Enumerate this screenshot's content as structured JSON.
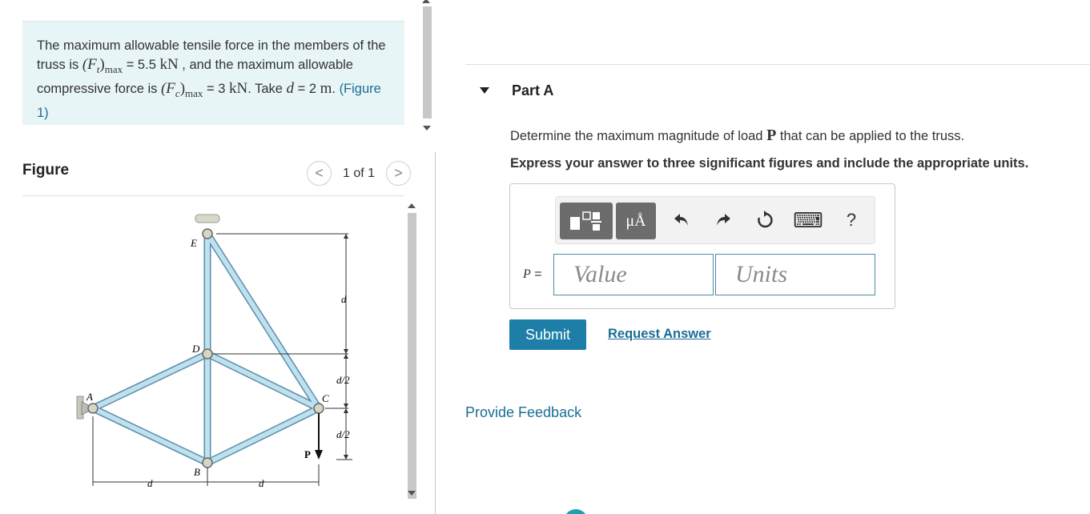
{
  "problem": {
    "text1": "The maximum allowable tensile force in the members of the truss is ",
    "ft_symbol": "(F",
    "ft_sub": "t",
    "ft_close": ")",
    "ft_max": "max",
    "ft_value": " = 5.5 ",
    "ft_unit": "kN",
    "text2": " , and the maximum allowable compressive force is ",
    "fc_symbol": "(F",
    "fc_sub": "c",
    "fc_close": ")",
    "fc_max": "max",
    "fc_value": " = 3 ",
    "fc_unit": "kN",
    "text3": ". Take ",
    "d_symbol": "d",
    "d_value": " = 2 ",
    "d_unit": "m",
    "text4": ". ",
    "figure_link": "(Figure 1)"
  },
  "figure": {
    "title": "Figure",
    "pager_text": "1 of 1",
    "prev_glyph": "<",
    "next_glyph": ">",
    "labels": {
      "E": "E",
      "D": "D",
      "A": "A",
      "C": "C",
      "B": "B",
      "P": "P",
      "d_right": "d",
      "d2_upper": "d/2",
      "d2_lower": "d/2",
      "d_bottom_left": "d",
      "d_bottom_right": "d"
    }
  },
  "part": {
    "title": "Part A",
    "question_pre": "Determine the maximum magnitude of load ",
    "question_var": "P",
    "question_post": " that can be applied to the truss.",
    "instruction": "Express your answer to three significant figures and include the appropriate units."
  },
  "toolbar": {
    "units_glyph": "μÅ",
    "keyboard_glyph": "⌨",
    "help_glyph": "?"
  },
  "answer": {
    "label_var": "P",
    "label_eq": " =",
    "value_placeholder": "Value",
    "units_placeholder": "Units"
  },
  "actions": {
    "submit": "Submit",
    "request_answer": "Request Answer",
    "feedback": "Provide Feedback"
  },
  "colors": {
    "accent": "#1d7ea8",
    "link": "#1a6e95",
    "problem_bg": "#e8f5f6",
    "member_fill": "#bfe0ef",
    "member_stroke": "#5a8ea8"
  }
}
